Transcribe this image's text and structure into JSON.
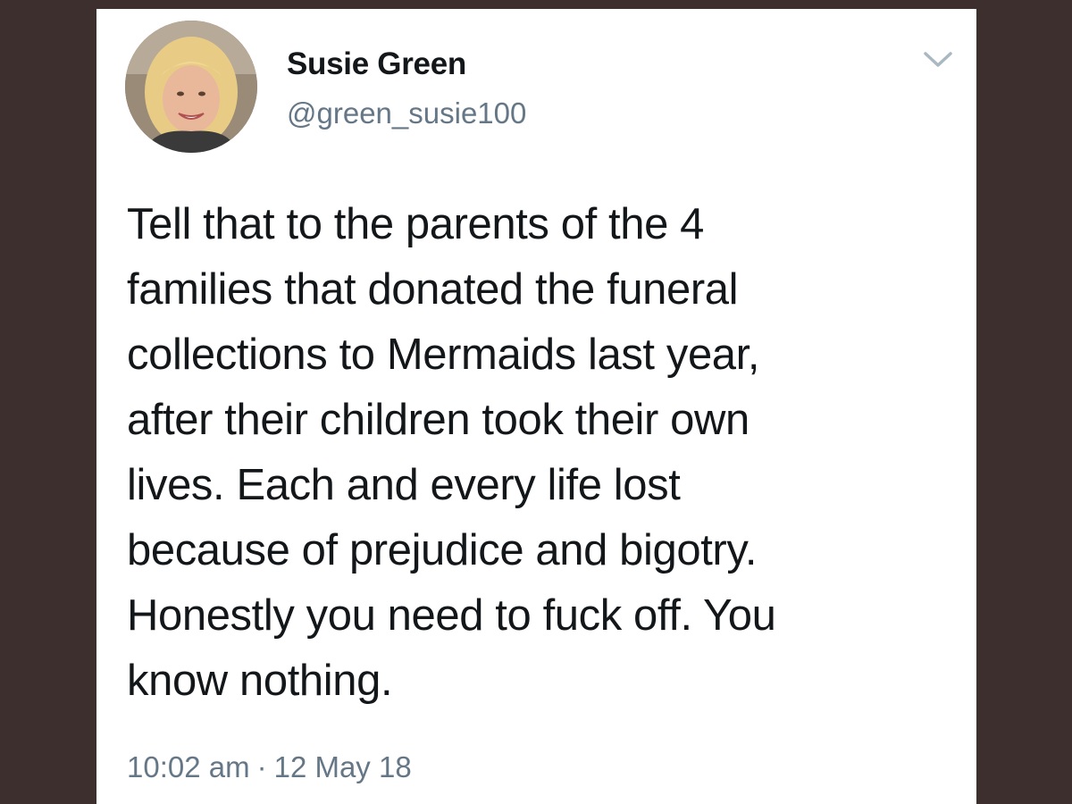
{
  "tweet": {
    "display_name": "Susie Green",
    "handle": "@green_susie100",
    "text_lines": [
      "Tell that to the parents of the 4",
      "families that donated the funeral",
      "collections to Mermaids last year,",
      "after their children took their own",
      "lives. Each and every life lost",
      "because of prejudice and bigotry.",
      "Honestly you need to fuck off. You",
      "know nothing."
    ],
    "time": "10:02 am",
    "separator": "·",
    "date": "12 May 18",
    "menu_icon": "chevron-down-icon",
    "avatar_icon": "profile-photo"
  },
  "colors": {
    "background": "#3d2f2d",
    "card": "#ffffff",
    "text": "#14171a",
    "secondary": "#657786"
  }
}
